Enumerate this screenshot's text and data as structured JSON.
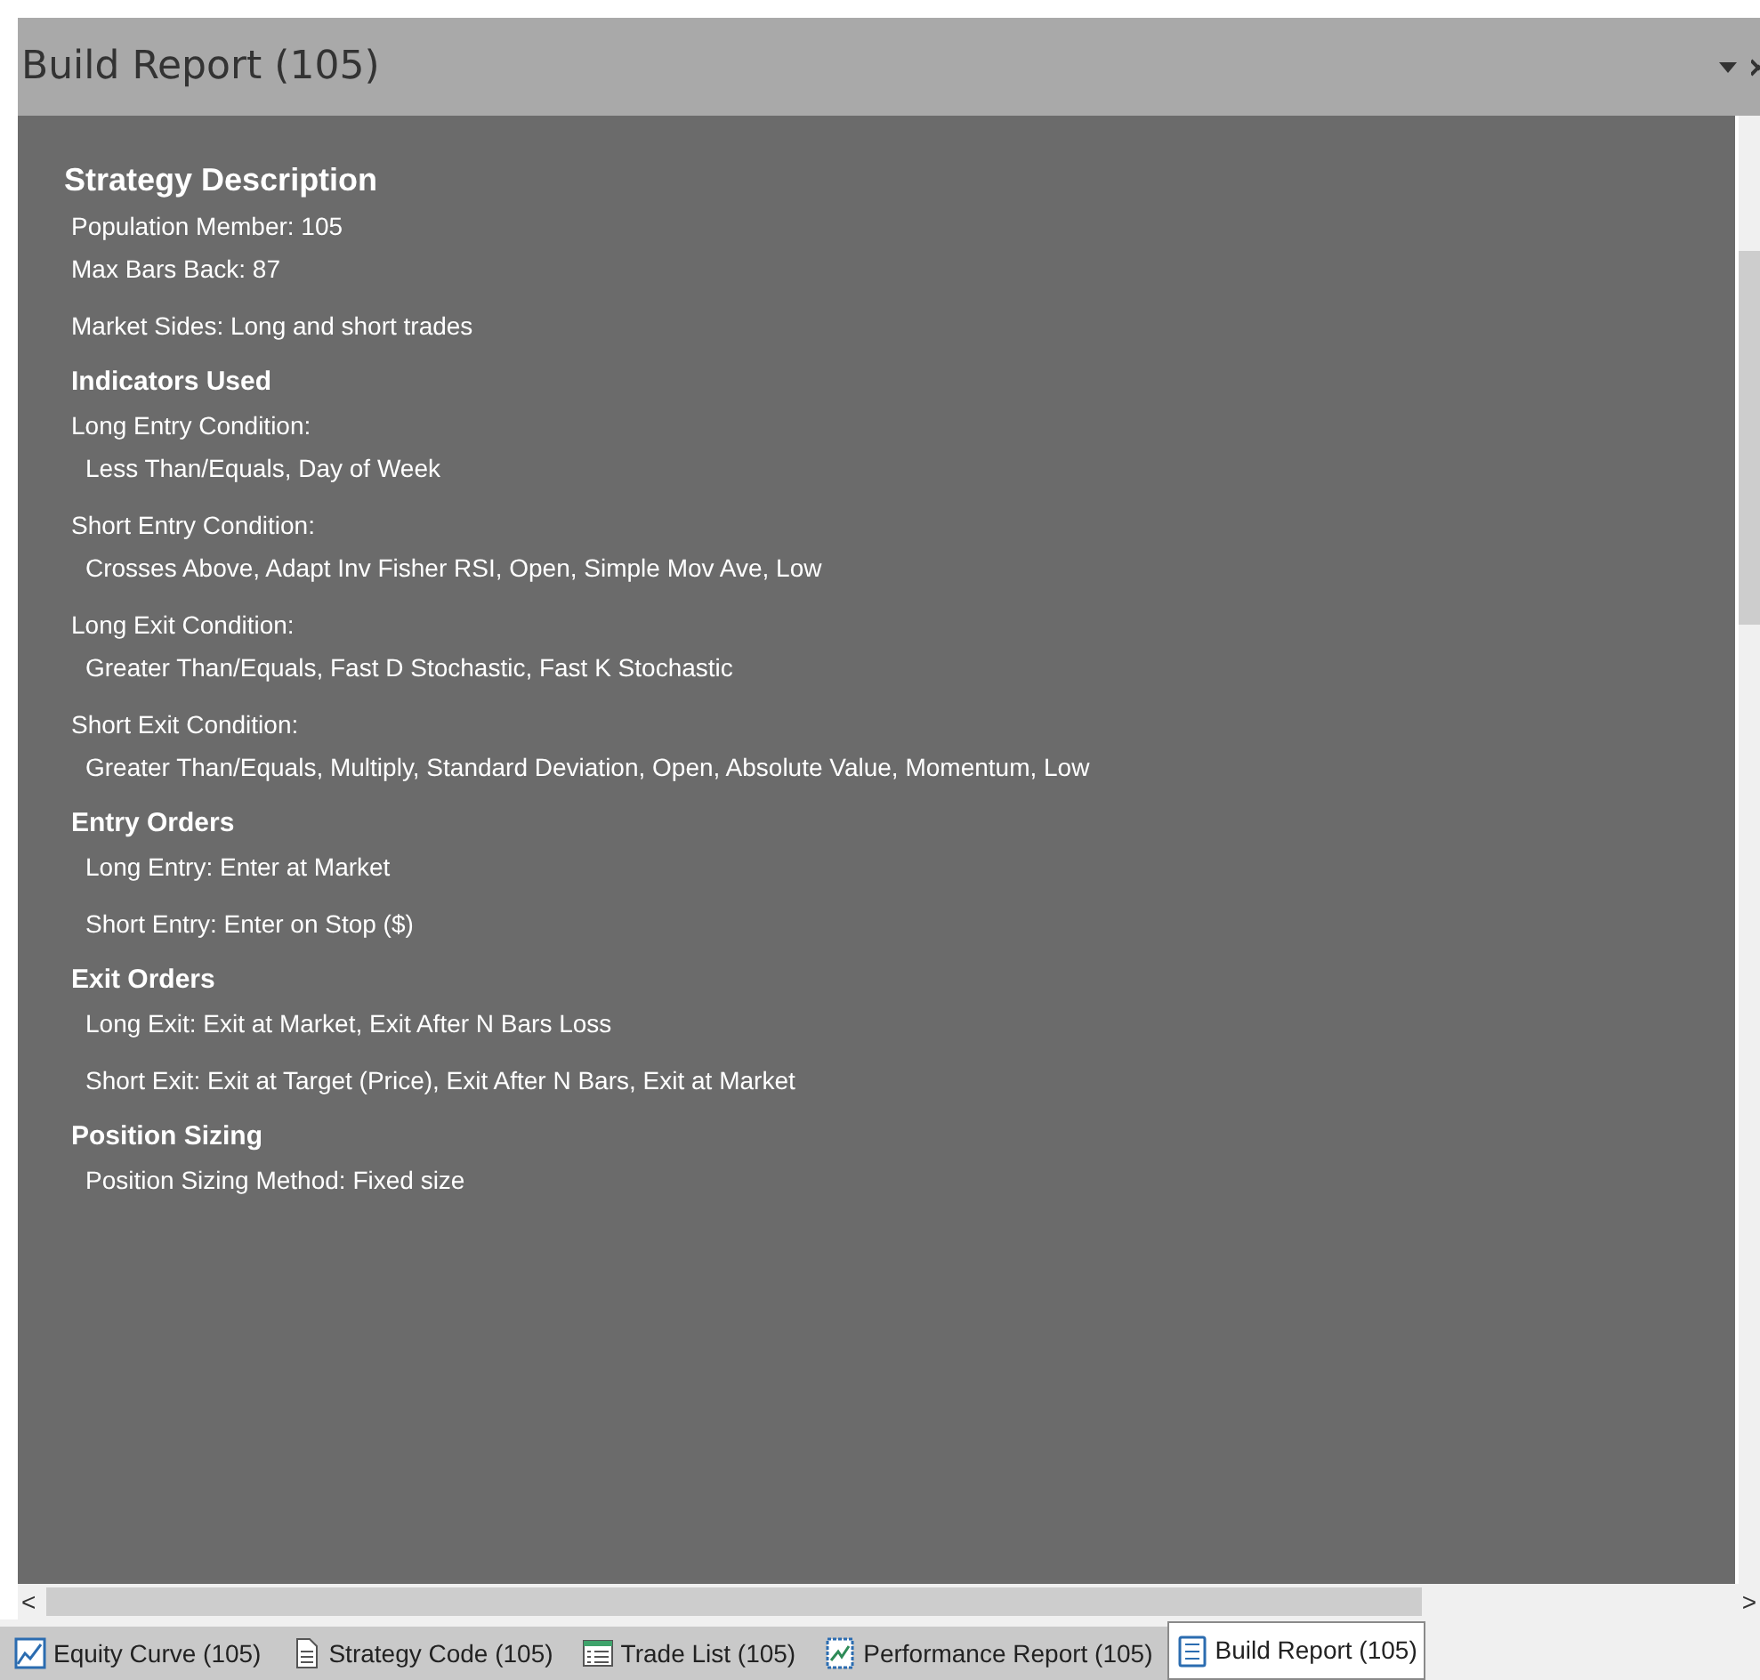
{
  "panel": {
    "title": "Build Report (105)"
  },
  "report": {
    "groups": [
      {
        "lines": [
          {
            "kind": "title",
            "text": "Strategy Description"
          },
          {
            "kind": "text",
            "text": "Population Member: 105"
          },
          {
            "kind": "text",
            "text": "Max Bars Back: 87"
          }
        ]
      },
      {
        "lines": [
          {
            "kind": "text",
            "text": "Market Sides: Long and short trades"
          }
        ]
      },
      {
        "lines": [
          {
            "kind": "section",
            "text": "Indicators Used"
          },
          {
            "kind": "text",
            "text": "Long Entry Condition:"
          },
          {
            "kind": "detail",
            "text": "Less Than/Equals, Day of Week"
          }
        ]
      },
      {
        "lines": [
          {
            "kind": "text",
            "text": "Short Entry Condition:"
          },
          {
            "kind": "detail",
            "text": "Crosses Above, Adapt Inv Fisher RSI, Open, Simple Mov Ave, Low"
          }
        ]
      },
      {
        "lines": [
          {
            "kind": "text",
            "text": "Long Exit Condition:"
          },
          {
            "kind": "detail",
            "text": "Greater Than/Equals, Fast D Stochastic, Fast K Stochastic"
          }
        ]
      },
      {
        "lines": [
          {
            "kind": "text",
            "text": "Short Exit Condition:"
          },
          {
            "kind": "detail",
            "text": "Greater Than/Equals, Multiply, Standard Deviation, Open, Absolute Value, Momentum, Low"
          }
        ]
      },
      {
        "lines": [
          {
            "kind": "section",
            "text": "Entry Orders"
          },
          {
            "kind": "detail",
            "text": "Long Entry: Enter at Market"
          }
        ]
      },
      {
        "lines": [
          {
            "kind": "detail",
            "text": "Short Entry: Enter on Stop ($)"
          }
        ]
      },
      {
        "lines": [
          {
            "kind": "section",
            "text": "Exit Orders"
          },
          {
            "kind": "detail",
            "text": "Long Exit: Exit at Market, Exit After N Bars Loss"
          }
        ]
      },
      {
        "lines": [
          {
            "kind": "detail",
            "text": "Short Exit: Exit at Target (Price), Exit After N Bars, Exit at Market"
          }
        ]
      },
      {
        "lines": [
          {
            "kind": "section",
            "text": "Position Sizing"
          },
          {
            "kind": "detail",
            "text": "Position Sizing Method: Fixed size"
          }
        ]
      }
    ]
  },
  "scroll_arrows": {
    "left": "<",
    "right": ">"
  },
  "tabs": [
    {
      "kind": "chart",
      "label": "Equity Curve (105)",
      "selected": false
    },
    {
      "kind": "code",
      "label": "Strategy Code (105)",
      "selected": false
    },
    {
      "kind": "list",
      "label": "Trade List (105)",
      "selected": false
    },
    {
      "kind": "report",
      "label": "Performance Report (105)",
      "selected": false
    },
    {
      "kind": "build",
      "label": "Build Report (105)",
      "selected": true
    }
  ]
}
